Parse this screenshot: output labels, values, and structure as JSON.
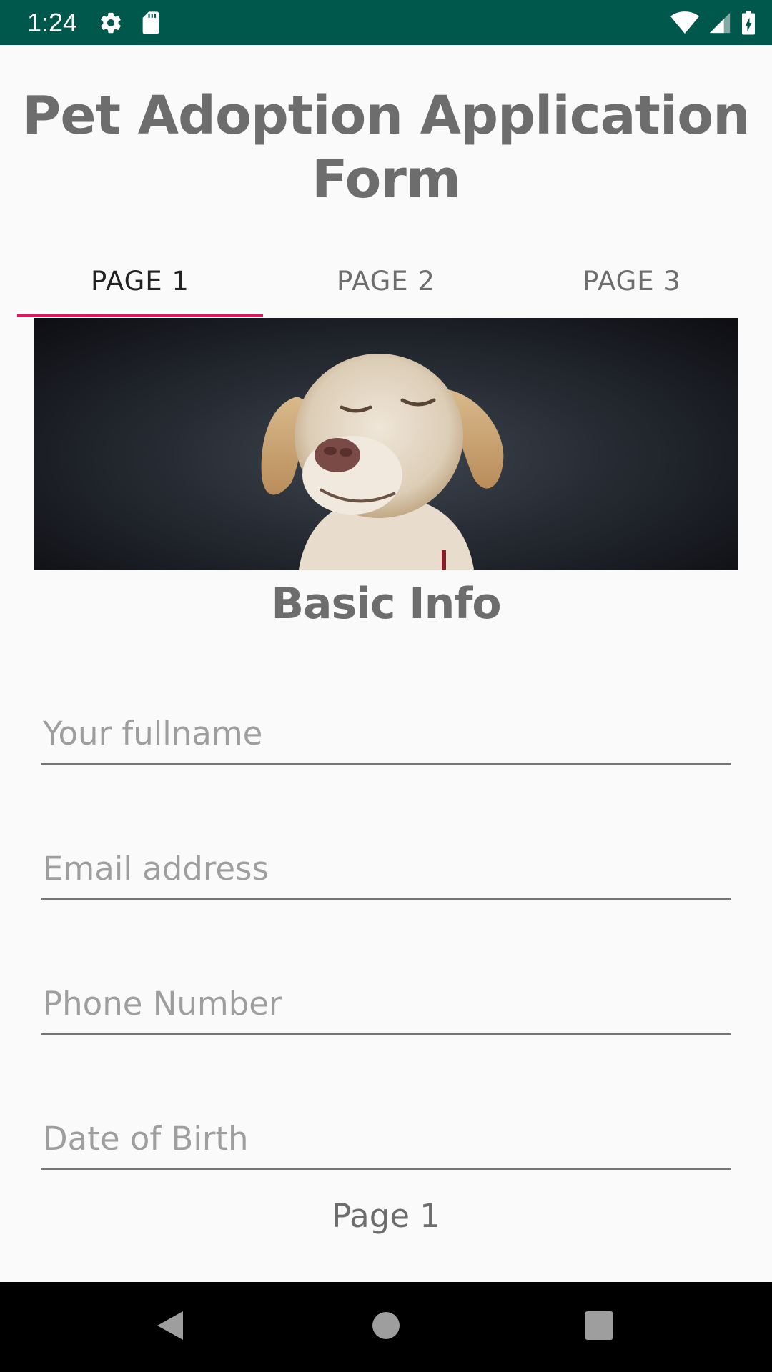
{
  "status_bar": {
    "time": "1:24",
    "background": "#00574b",
    "icons": [
      "gear-icon",
      "sd-card-icon",
      "wifi-icon",
      "cell-signal-icon",
      "battery-icon"
    ]
  },
  "title": "Pet Adoption Application Form",
  "tabs": [
    {
      "label": "PAGE 1",
      "active": true
    },
    {
      "label": "PAGE 2",
      "active": false
    },
    {
      "label": "PAGE 3",
      "active": false
    }
  ],
  "accent_color": "#d81b60",
  "hero_image": {
    "subject": "dog photo"
  },
  "section_heading": "Basic Info",
  "form": {
    "fullname": {
      "placeholder": "Your fullname",
      "value": ""
    },
    "email": {
      "placeholder": "Email address",
      "value": ""
    },
    "phone": {
      "placeholder": "Phone Number",
      "value": ""
    },
    "dob": {
      "placeholder": "Date of Birth",
      "value": ""
    }
  },
  "page_label": "Page 1",
  "nav_bar": {
    "buttons": [
      "back-icon",
      "home-icon",
      "recents-icon"
    ]
  }
}
